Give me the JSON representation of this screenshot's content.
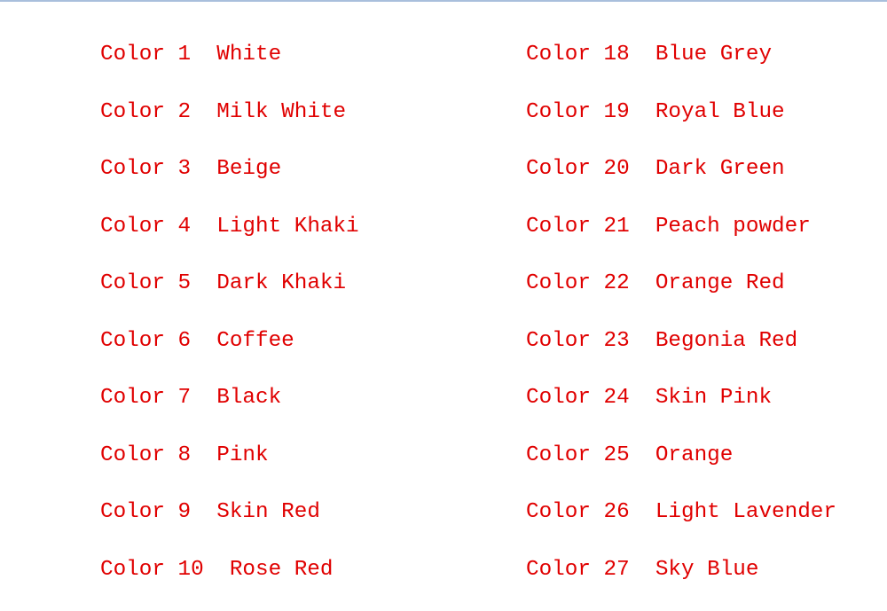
{
  "text_color": "#e00000",
  "left_column": [
    {
      "label": "Color 1",
      "name": "White"
    },
    {
      "label": "Color 2",
      "name": "Milk White"
    },
    {
      "label": "Color 3",
      "name": "Beige"
    },
    {
      "label": "Color 4",
      "name": "Light Khaki"
    },
    {
      "label": "Color 5",
      "name": "Dark Khaki"
    },
    {
      "label": "Color 6",
      "name": "Coffee"
    },
    {
      "label": "Color 7",
      "name": "Black"
    },
    {
      "label": "Color 8",
      "name": "Pink"
    },
    {
      "label": "Color 9",
      "name": "Skin Red"
    },
    {
      "label": "Color 10",
      "name": "Rose Red"
    }
  ],
  "right_column": [
    {
      "label": "Color 18",
      "name": "Blue Grey"
    },
    {
      "label": "Color 19",
      "name": "Royal Blue"
    },
    {
      "label": "Color 20",
      "name": "Dark Green"
    },
    {
      "label": "Color 21",
      "name": "Peach powder"
    },
    {
      "label": "Color 22",
      "name": "Orange Red"
    },
    {
      "label": "Color 23",
      "name": "Begonia Red"
    },
    {
      "label": "Color 24",
      "name": "Skin Pink"
    },
    {
      "label": "Color 25",
      "name": "Orange"
    },
    {
      "label": "Color 26",
      "name": "Light Lavender"
    },
    {
      "label": "Color 27",
      "name": "Sky Blue"
    }
  ]
}
